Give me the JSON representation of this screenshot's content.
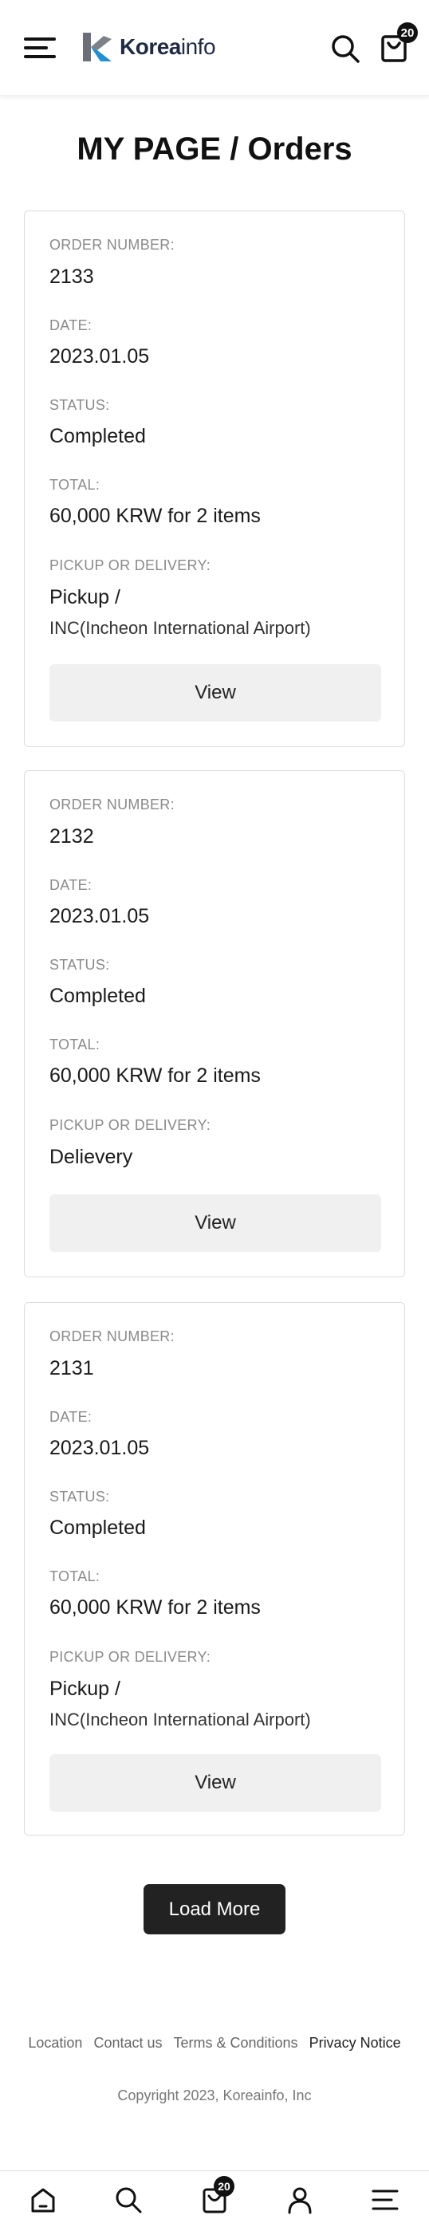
{
  "header": {
    "logo_bold": "Korea",
    "logo_thin": "info",
    "cart_count": "20"
  },
  "page": {
    "title": "MY PAGE / Orders"
  },
  "labels": {
    "order_number": "ORDER NUMBER:",
    "date": "DATE:",
    "status": "STATUS:",
    "total": "TOTAL:",
    "pickup": "PICKUP OR DELIVERY:",
    "view": "View"
  },
  "orders": [
    {
      "number": "2133",
      "date": "2023.01.05",
      "status": "Completed",
      "total": "60,000 KRW for 2 items",
      "method": "Pickup /",
      "location": "INC(Incheon International Airport)"
    },
    {
      "number": "2132",
      "date": "2023.01.05",
      "status": "Completed",
      "total": "60,000 KRW for 2 items",
      "method": "Delievery",
      "location": ""
    },
    {
      "number": "2131",
      "date": "2023.01.05",
      "status": "Completed",
      "total": "60,000 KRW for 2 items",
      "method": "Pickup /",
      "location": "INC(Incheon International Airport)"
    }
  ],
  "load_more": "Load More",
  "footer": {
    "links": [
      "Location",
      "Contact us",
      "Terms & Conditions",
      "Privacy Notice"
    ],
    "copyright": "Copyright 2023, Koreainfo, Inc"
  },
  "bottom_nav": {
    "cart_count": "20"
  }
}
